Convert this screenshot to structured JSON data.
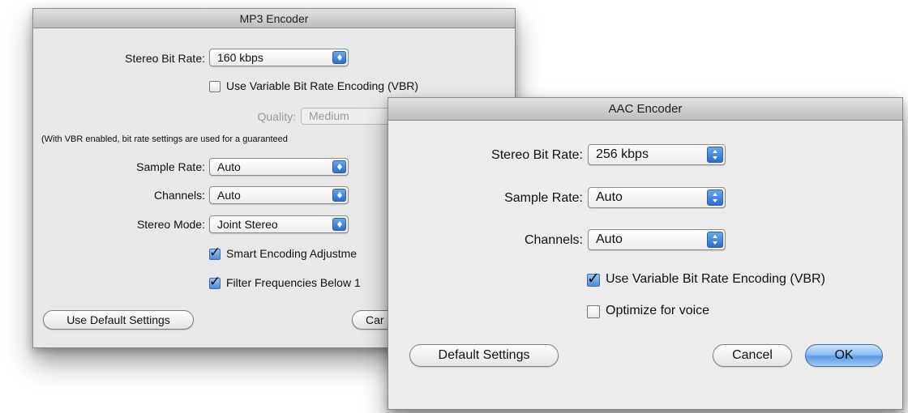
{
  "mp3": {
    "title": "MP3 Encoder",
    "stereo_bit_rate_label": "Stereo Bit Rate:",
    "stereo_bit_rate_value": "160 kbps",
    "vbr_label": "Use Variable Bit Rate Encoding (VBR)",
    "vbr_checked": false,
    "quality_label": "Quality:",
    "quality_value": "Medium",
    "vbr_note": "(With VBR enabled, bit rate settings are used for a guaranteed",
    "sample_rate_label": "Sample Rate:",
    "sample_rate_value": "Auto",
    "channels_label": "Channels:",
    "channels_value": "Auto",
    "stereo_mode_label": "Stereo Mode:",
    "stereo_mode_value": "Joint Stereo",
    "smart_encoding_label": "Smart Encoding Adjustme",
    "smart_encoding_checked": true,
    "filter_label": "Filter Frequencies Below 1",
    "filter_checked": true,
    "default_button": "Use Default Settings",
    "cancel_button": "Car"
  },
  "aac": {
    "title": "AAC Encoder",
    "stereo_bit_rate_label": "Stereo Bit Rate:",
    "stereo_bit_rate_value": "256 kbps",
    "sample_rate_label": "Sample Rate:",
    "sample_rate_value": "Auto",
    "channels_label": "Channels:",
    "channels_value": "Auto",
    "vbr_label": "Use Variable Bit Rate Encoding (VBR)",
    "vbr_checked": true,
    "voice_label": "Optimize for voice",
    "voice_checked": false,
    "default_button": "Default Settings",
    "cancel_button": "Cancel",
    "ok_button": "OK"
  },
  "colors": {
    "dialog_bg": "#e8e8e8",
    "accent": "#5a9ae5"
  },
  "icons": {
    "popup_arrows": "up-down-arrows-icon",
    "checkmark": "checkmark-icon"
  },
  "glyphs": {
    "check": "✓"
  }
}
